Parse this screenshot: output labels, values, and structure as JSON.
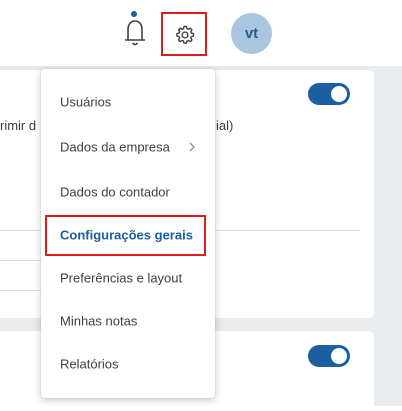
{
  "header": {
    "avatar_initials": "vt",
    "icons": [
      "bell-icon",
      "gear-icon"
    ],
    "notification_dot_color": "#1b5fa0",
    "highlight_color": "#e01b1b"
  },
  "background_card": {
    "text_left": "rimir d",
    "text_right": "ial)",
    "toggle_color": "#1b5fa0"
  },
  "menu": {
    "items": [
      {
        "label": "Usuários"
      },
      {
        "label": "Dados da empresa"
      },
      {
        "label": "Dados do contador"
      },
      {
        "label": "Configurações gerais"
      },
      {
        "label": "Preferências e layout"
      },
      {
        "label": "Minhas notas"
      },
      {
        "label": "Relatórios"
      }
    ],
    "active_color": "#1b5fa0"
  }
}
